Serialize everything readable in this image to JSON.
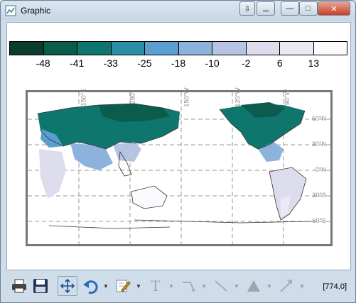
{
  "window": {
    "title": "Graphic",
    "buttons": [
      "expand-icon",
      "pin-icon",
      "minimize-icon",
      "maximize-icon",
      "close-icon"
    ]
  },
  "colorbar": {
    "colors": [
      "#0b3d2e",
      "#0b5c4d",
      "#0f766e",
      "#2b8fa8",
      "#5a9fcf",
      "#8db3dc",
      "#b7c3e2",
      "#dcdcec",
      "#eee8f4",
      "#fbfbfd"
    ],
    "labels": [
      "-48",
      "-41",
      "-33",
      "-25",
      "-18",
      "-10",
      "-2",
      "6",
      "13"
    ]
  },
  "map": {
    "lon_labels": [
      "150°E",
      "180°",
      "150°W",
      "120°W",
      "90°W"
    ],
    "lat_labels": [
      "60°N",
      "30°N",
      "0°N",
      "30°S",
      "60°S"
    ]
  },
  "toolbar": {
    "tools": [
      "print-icon",
      "save-icon",
      "zoom-extent-icon",
      "undo-icon",
      "pencil-icon",
      "text-icon",
      "arrow-draw-icon",
      "line-icon",
      "triangle-icon",
      "arrow-icon"
    ],
    "coordinates": "[774,0]"
  }
}
